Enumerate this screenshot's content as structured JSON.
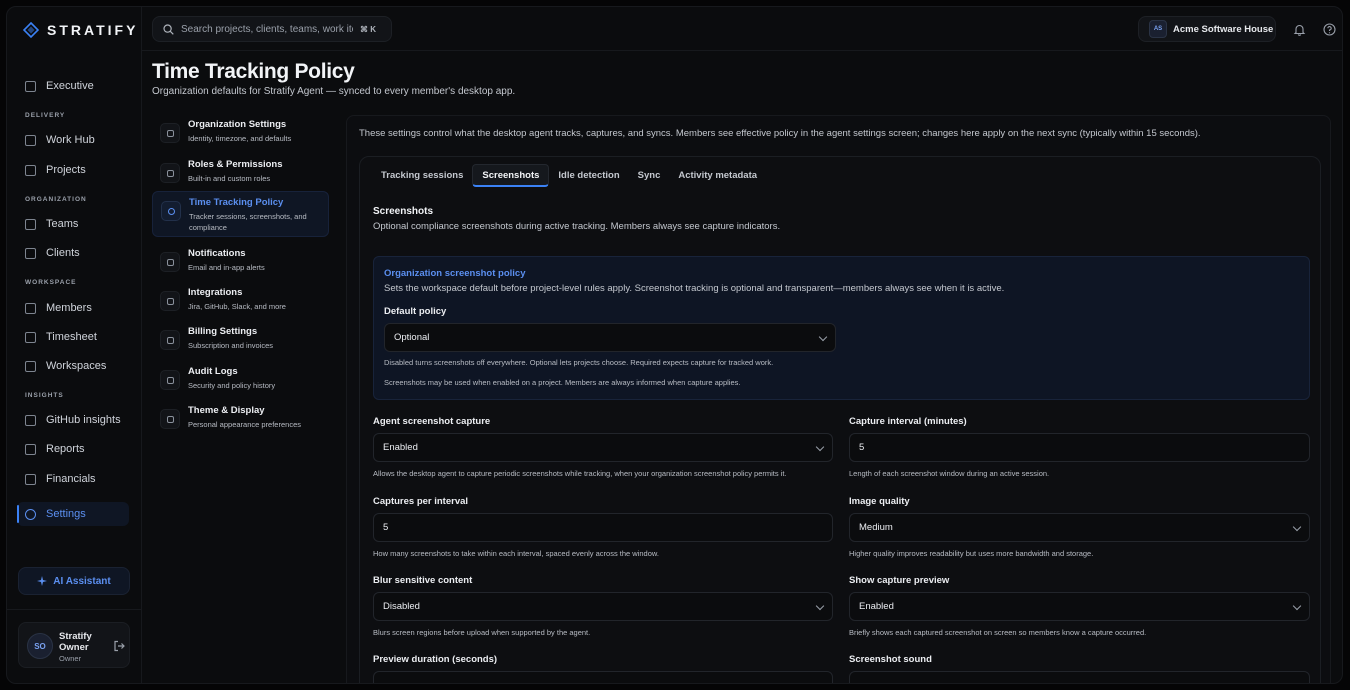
{
  "brand": {
    "name": "STRATIFY"
  },
  "sidebar": {
    "items": [
      {
        "label": "Executive",
        "icon": "home-icon"
      },
      {
        "section": "DELIVERY"
      },
      {
        "label": "Work Hub",
        "icon": "briefcase-icon"
      },
      {
        "label": "Projects",
        "icon": "folder-icon"
      },
      {
        "section": "ORGANIZATION"
      },
      {
        "label": "Teams",
        "icon": "team-icon"
      },
      {
        "label": "Clients",
        "icon": "clients-icon"
      },
      {
        "section": "WORKSPACE"
      },
      {
        "label": "Members",
        "icon": "members-icon"
      },
      {
        "label": "Timesheet",
        "icon": "calendar-icon"
      },
      {
        "label": "Workspaces",
        "icon": "layers-icon"
      },
      {
        "section": "INSIGHTS"
      },
      {
        "label": "GitHub insights",
        "icon": "github-icon"
      },
      {
        "label": "Reports",
        "icon": "reports-icon"
      },
      {
        "label": "Financials",
        "icon": "financials-icon"
      },
      {
        "label": "Settings",
        "icon": "gear-icon",
        "active": true
      }
    ],
    "ai_assistant": "AI Assistant",
    "user": {
      "initials": "SO",
      "name": "Stratify Owner",
      "role": "Owner"
    }
  },
  "topbar": {
    "search_placeholder": "Search projects, clients, teams, work items...",
    "shortcut": "⌘ K",
    "org": {
      "initials": "AS",
      "name": "Acme Software House"
    }
  },
  "page": {
    "title": "Time Tracking Policy",
    "subtitle": "Organization defaults for Stratify Agent — synced to every member's desktop app."
  },
  "settings_nav": [
    {
      "title": "Organization Settings",
      "desc": "Identity, timezone, and defaults"
    },
    {
      "title": "Roles & Permissions",
      "desc": "Built-in and custom roles"
    },
    {
      "title": "Time Tracking Policy",
      "desc": "Tracker sessions, screenshots, and compliance",
      "active": true
    },
    {
      "title": "Notifications",
      "desc": "Email and in-app alerts"
    },
    {
      "title": "Integrations",
      "desc": "Jira, GitHub, Slack, and more"
    },
    {
      "title": "Billing Settings",
      "desc": "Subscription and invoices"
    },
    {
      "title": "Audit Logs",
      "desc": "Security and policy history"
    },
    {
      "title": "Theme & Display",
      "desc": "Personal appearance preferences"
    }
  ],
  "content": {
    "intro": "These settings control what the desktop agent tracks, captures, and syncs. Members see effective policy in the agent settings screen; changes here apply on the next sync (typically within 15 seconds).",
    "tabs": [
      "Tracking sessions",
      "Screenshots",
      "Idle detection",
      "Sync",
      "Activity metadata"
    ],
    "active_tab": "Screenshots",
    "section": {
      "title": "Screenshots",
      "desc": "Optional compliance screenshots during active tracking. Members always see capture indicators."
    },
    "org_policy": {
      "title": "Organization screenshot policy",
      "desc": "Sets the workspace default before project-level rules apply. Screenshot tracking is optional and transparent—members always see when it is active.",
      "label": "Default policy",
      "value": "Optional",
      "help1": "Disabled turns screenshots off everywhere. Optional lets projects choose. Required expects capture for tracked work.",
      "help2": "Screenshots may be used when enabled on a project. Members are always informed when capture applies."
    },
    "fields": {
      "agent_capture": {
        "label": "Agent screenshot capture",
        "value": "Enabled",
        "help": "Allows the desktop agent to capture periodic screenshots while tracking, when your organization screenshot policy permits it."
      },
      "capture_interval": {
        "label": "Capture interval (minutes)",
        "value": "5",
        "help": "Length of each screenshot window during an active session."
      },
      "captures_per_interval": {
        "label": "Captures per interval",
        "value": "5",
        "help": "How many screenshots to take within each interval, spaced evenly across the window."
      },
      "image_quality": {
        "label": "Image quality",
        "value": "Medium",
        "help": "Higher quality improves readability but uses more bandwidth and storage."
      },
      "blur": {
        "label": "Blur sensitive content",
        "value": "Disabled",
        "help": "Blurs screen regions before upload when supported by the agent."
      },
      "show_preview": {
        "label": "Show capture preview",
        "value": "Enabled",
        "help": "Briefly shows each captured screenshot on screen so members know a capture occurred."
      },
      "preview_duration": {
        "label": "Preview duration (seconds)"
      },
      "sound": {
        "label": "Screenshot sound"
      }
    }
  },
  "colors": {
    "accent": "#3b82f6",
    "background": "#0b0c0e"
  }
}
